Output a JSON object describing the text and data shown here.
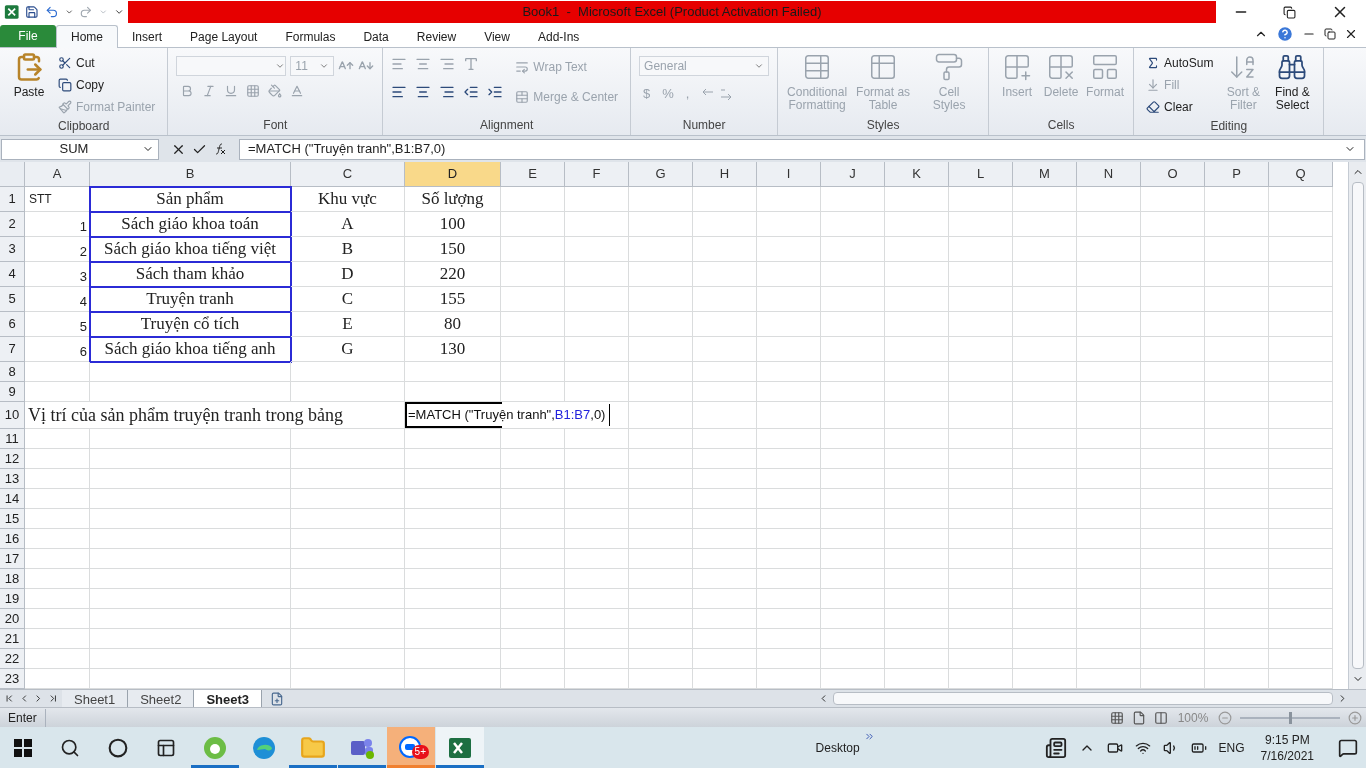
{
  "title_bar": {
    "title": "Book1  -  Microsoft Excel (Product Activation Failed)"
  },
  "file_tab": "File",
  "ribbon_tabs": [
    {
      "label": "Home",
      "selected": true
    },
    {
      "label": "Insert",
      "selected": false
    },
    {
      "label": "Page Layout",
      "selected": false
    },
    {
      "label": "Formulas",
      "selected": false
    },
    {
      "label": "Data",
      "selected": false
    },
    {
      "label": "Review",
      "selected": false
    },
    {
      "label": "View",
      "selected": false
    },
    {
      "label": "Add-Ins",
      "selected": false
    }
  ],
  "ribbon_groups": [
    {
      "kind": "clipboard",
      "label": "Clipboard",
      "items": [
        {
          "label": "Paste",
          "disabled": false
        },
        {
          "label": "Cut",
          "disabled": false
        },
        {
          "label": "Copy",
          "disabled": false
        },
        {
          "label": "Format Painter",
          "disabled": true
        }
      ]
    },
    {
      "kind": "font",
      "label": "Font",
      "font_size": "11",
      "disabled": true
    },
    {
      "kind": "alignment",
      "label": "Alignment",
      "items": [
        {
          "label": "Wrap Text",
          "disabled": true
        },
        {
          "label": "Merge & Center",
          "disabled": true
        }
      ]
    },
    {
      "kind": "number",
      "label": "Number",
      "format": "General",
      "symbols": [
        "$",
        "%",
        ","
      ],
      "disabled": true
    },
    {
      "kind": "styles",
      "label": "Styles",
      "items": [
        {
          "label": "Conditional Formatting",
          "disabled": true
        },
        {
          "label": "Format as Table",
          "disabled": true
        },
        {
          "label": "Cell Styles",
          "disabled": true
        }
      ]
    },
    {
      "kind": "cells",
      "label": "Cells",
      "items": [
        {
          "label": "Insert",
          "disabled": true
        },
        {
          "label": "Delete",
          "disabled": true
        },
        {
          "label": "Format",
          "disabled": true
        }
      ]
    },
    {
      "kind": "editing",
      "label": "Editing",
      "items": [
        {
          "label": "AutoSum",
          "disabled": false
        },
        {
          "label": "Fill",
          "disabled": true
        },
        {
          "label": "Clear",
          "disabled": false
        },
        {
          "label": "Sort & Filter",
          "disabled": true
        },
        {
          "label": "Find & Select",
          "disabled": false
        }
      ]
    }
  ],
  "formula_bar": {
    "name_box": "SUM",
    "formula": "=MATCH (\"Truyện tranh\",B1:B7,0)"
  },
  "columns": [
    {
      "label": "A",
      "selected": false
    },
    {
      "label": "B",
      "selected": false
    },
    {
      "label": "C",
      "selected": false
    },
    {
      "label": "D",
      "selected": true
    },
    {
      "label": "E",
      "selected": false
    },
    {
      "label": "F",
      "selected": false
    },
    {
      "label": "G",
      "selected": false
    },
    {
      "label": "H",
      "selected": false
    },
    {
      "label": "I",
      "selected": false
    },
    {
      "label": "J",
      "selected": false
    },
    {
      "label": "K",
      "selected": false
    },
    {
      "label": "L",
      "selected": false
    },
    {
      "label": "M",
      "selected": false
    },
    {
      "label": "N",
      "selected": false
    },
    {
      "label": "O",
      "selected": false
    },
    {
      "label": "P",
      "selected": false
    },
    {
      "label": "Q",
      "selected": false
    }
  ],
  "rows": [
    {
      "label": "1",
      "cells": {
        "A": {
          "kind": "label",
          "text": "STT"
        },
        "B": {
          "kind": "centered",
          "text": "Sản phẩm",
          "in_range": true
        },
        "C": {
          "kind": "centered",
          "text": "Khu vực"
        },
        "D": {
          "kind": "centered",
          "text": "Số lượng"
        }
      }
    },
    {
      "label": "2",
      "cells": {
        "A": {
          "kind": "count",
          "text": "1"
        },
        "B": {
          "kind": "centered",
          "text": "Sách giáo khoa toán",
          "in_range": true
        },
        "C": {
          "kind": "centered",
          "text": "A"
        },
        "D": {
          "kind": "centered",
          "text": "100"
        }
      }
    },
    {
      "label": "3",
      "cells": {
        "A": {
          "kind": "count",
          "text": "2"
        },
        "B": {
          "kind": "centered",
          "text": "Sách giáo khoa tiếng việt",
          "in_range": true
        },
        "C": {
          "kind": "centered",
          "text": "B"
        },
        "D": {
          "kind": "centered",
          "text": "150"
        }
      }
    },
    {
      "label": "4",
      "cells": {
        "A": {
          "kind": "count",
          "text": "3"
        },
        "B": {
          "kind": "centered",
          "text": "Sách tham khảo",
          "in_range": true
        },
        "C": {
          "kind": "centered",
          "text": "D"
        },
        "D": {
          "kind": "centered",
          "text": "220"
        }
      }
    },
    {
      "label": "5",
      "cells": {
        "A": {
          "kind": "count",
          "text": "4"
        },
        "B": {
          "kind": "centered",
          "text": "Truyện tranh",
          "in_range": true
        },
        "C": {
          "kind": "centered",
          "text": "C"
        },
        "D": {
          "kind": "centered",
          "text": "155"
        }
      }
    },
    {
      "label": "6",
      "cells": {
        "A": {
          "kind": "count",
          "text": "5"
        },
        "B": {
          "kind": "centered",
          "text": "Truyện cổ tích",
          "in_range": true
        },
        "C": {
          "kind": "centered",
          "text": "E"
        },
        "D": {
          "kind": "centered",
          "text": "80"
        }
      }
    },
    {
      "label": "7",
      "cells": {
        "A": {
          "kind": "count",
          "text": "6"
        },
        "B": {
          "kind": "centered",
          "text": "Sách giáo khoa tiếng anh",
          "in_range": true
        },
        "C": {
          "kind": "centered",
          "text": "G"
        },
        "D": {
          "kind": "centered",
          "text": "130"
        }
      }
    },
    {
      "label": "8",
      "cells": {}
    },
    {
      "label": "9",
      "cells": {}
    },
    {
      "label": "10",
      "cells": {
        "A": {
          "kind": "note",
          "text": "Vị trí của sản phẩm truyện tranh trong bảng"
        },
        "D": {
          "kind": "editing",
          "parts": [
            {
              "kind": "text",
              "text": "=MATCH (\"Truyện tranh\","
            },
            {
              "kind": "reference",
              "text": "B1:B7"
            },
            {
              "kind": "text",
              "text": ",0)"
            }
          ]
        }
      }
    },
    {
      "label": "11",
      "cells": {}
    },
    {
      "label": "12",
      "cells": {}
    },
    {
      "label": "13",
      "cells": {}
    },
    {
      "label": "14",
      "cells": {}
    },
    {
      "label": "15",
      "cells": {}
    },
    {
      "label": "16",
      "cells": {}
    },
    {
      "label": "17",
      "cells": {}
    },
    {
      "label": "18",
      "cells": {}
    },
    {
      "label": "19",
      "cells": {}
    },
    {
      "label": "20",
      "cells": {}
    },
    {
      "label": "21",
      "cells": {}
    },
    {
      "label": "22",
      "cells": {}
    },
    {
      "label": "23",
      "cells": {}
    }
  ],
  "sheet_tabs": [
    {
      "label": "Sheet1",
      "selected": false
    },
    {
      "label": "Sheet2",
      "selected": false
    },
    {
      "label": "Sheet3",
      "selected": true
    }
  ],
  "status_bar": {
    "mode": "Enter",
    "zoom": "100%",
    "zoom_level": {
      "level": 0.5
    }
  },
  "taskbar": {
    "apps": [
      {
        "kind": "coccoc",
        "running": true,
        "active": false,
        "highlighted": false
      },
      {
        "kind": "edge",
        "running": false,
        "active": false,
        "highlighted": false
      },
      {
        "kind": "explorer",
        "running": true,
        "active": false,
        "highlighted": false
      },
      {
        "kind": "teams",
        "running": true,
        "active": false,
        "highlighted": false
      },
      {
        "kind": "zalo",
        "running": true,
        "active": false,
        "highlighted": true,
        "badge": "5+"
      },
      {
        "kind": "excel",
        "running": true,
        "active": true,
        "highlighted": false
      }
    ],
    "toolbar_label": "Desktop",
    "language": "ENG",
    "time": "9:15 PM",
    "date": "7/16/2021"
  }
}
